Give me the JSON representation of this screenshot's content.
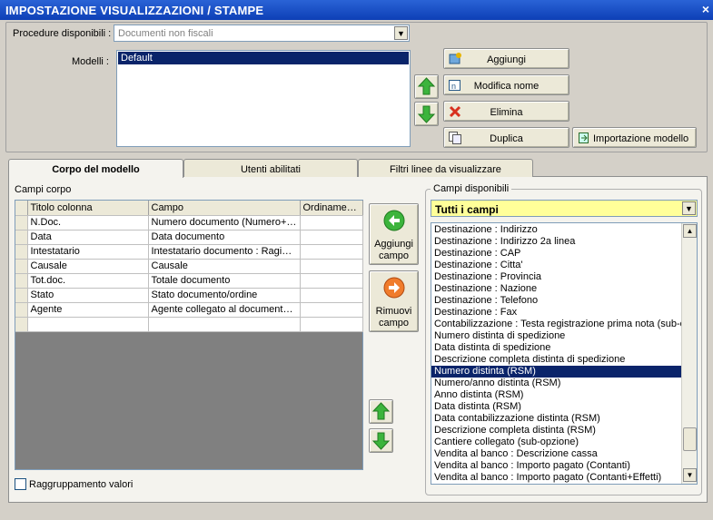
{
  "window": {
    "title": "IMPOSTAZIONE VISUALIZZAZIONI / STAMPE",
    "close": "×"
  },
  "procedure": {
    "label": "Procedure disponibili :",
    "value": "Documenti non fiscali"
  },
  "modelli": {
    "label": "Modelli :",
    "items": [
      "Default"
    ]
  },
  "buttons": {
    "aggiungi": "Aggiungi",
    "modifica": "Modifica nome",
    "elimina": "Elimina",
    "duplica": "Duplica",
    "importazione": "Importazione modello",
    "aggiungi_campo": "Aggiungi campo",
    "rimuovi_campo": "Rimuovi campo"
  },
  "tabs": [
    "Corpo del modello",
    "Utenti abilitati",
    "Filtri linee da visualizzare"
  ],
  "campi_corpo": {
    "label": "Campi corpo",
    "columns": [
      "Titolo colonna",
      "Campo",
      "Ordiname…"
    ],
    "rows": [
      [
        "N.Doc.",
        "Numero documento (Numero+…",
        ""
      ],
      [
        "Data",
        "Data documento",
        ""
      ],
      [
        "Intestatario",
        "Intestatario documento : Ragi…",
        ""
      ],
      [
        "Causale",
        "Causale",
        ""
      ],
      [
        "Tot.doc.",
        "Totale documento",
        ""
      ],
      [
        "Stato",
        "Stato documento/ordine",
        ""
      ],
      [
        "Agente",
        "Agente collegato al documento…",
        ""
      ],
      [
        "",
        "",
        ""
      ]
    ]
  },
  "raggruppamento": {
    "label": "Raggruppamento valori",
    "checked": false
  },
  "campi_disponibili": {
    "label": "Campi disponibili",
    "filter": "Tutti i campi",
    "selected_index": 13,
    "items": [
      "Destinazione : Indirizzo",
      "Destinazione : Indirizzo 2a linea",
      "Destinazione : CAP",
      "Destinazione : Citta'",
      "Destinazione : Provincia",
      "Destinazione : Nazione",
      "Destinazione : Telefono",
      "Destinazione : Fax",
      "Contabilizzazione : Testa registrazione prima nota (sub-o",
      "Numero distinta di spedizione",
      "Data distinta di spedizione",
      "Descrizione completa distinta di spedizione",
      "Numero distinta (RSM)",
      "Numero/anno distinta (RSM)",
      "Anno distinta (RSM)",
      "Data distinta (RSM)",
      "Data contabilizzazione distinta (RSM)",
      "Descrizione completa distinta (RSM)",
      "Cantiere collegato (sub-opzione)",
      "Vendita al banco : Descrizione cassa",
      "Vendita al banco  : Importo pagato (Contanti)",
      "Vendita al banco : Importo pagato (Contanti+Effetti)"
    ]
  }
}
